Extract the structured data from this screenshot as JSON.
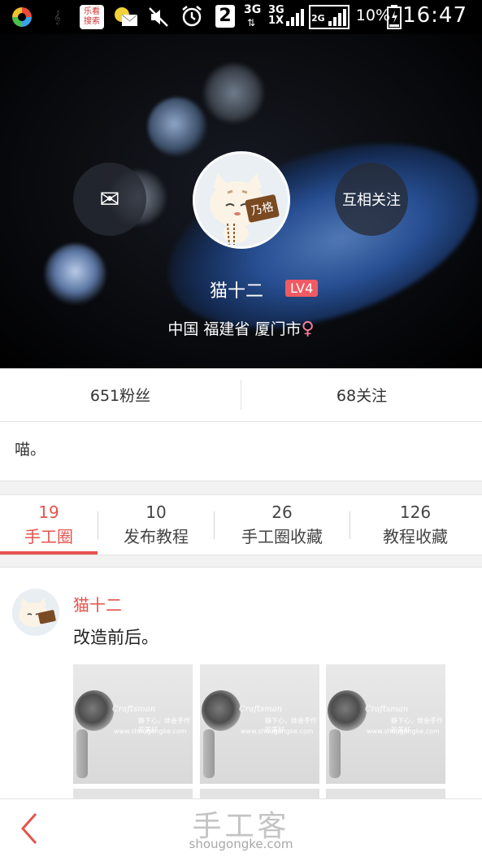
{
  "status_bar": {
    "app_badge": "乐看\n搜索",
    "notif_count": "2",
    "net_3g_top": "3G",
    "net_3g_1x": "3G\n1X",
    "net_2g": "2G",
    "battery": "10%",
    "time": "16:47",
    "icons": [
      "app-launcher-icon",
      "weather-icon",
      "leke-search-icon",
      "messages-icon",
      "mute-icon",
      "alarm-icon",
      "notification-count-icon",
      "signal-icon",
      "battery-icon"
    ]
  },
  "profile": {
    "name": "猫十二",
    "level": "LV4",
    "location": "中国 福建省 厦门市",
    "gender_symbol": "♀",
    "message_icon": "✉",
    "follow_each_other": "互相关注",
    "avatar_tag": "乃格"
  },
  "stats": {
    "fans": "651粉丝",
    "following": "68关注"
  },
  "bio": "喵。",
  "tabs": [
    {
      "count": "19",
      "label": "手工圈",
      "active": true
    },
    {
      "count": "10",
      "label": "发布教程",
      "active": false
    },
    {
      "count": "26",
      "label": "手工圈收藏",
      "active": false
    },
    {
      "count": "126",
      "label": "教程收藏",
      "active": false
    }
  ],
  "post": {
    "author": "猫十二",
    "text": "改造前后。",
    "thumb_text_1": "Craftsman",
    "thumb_text_2": "静下心，体会手作的美好",
    "thumb_text_3": "www.shougongke.com"
  },
  "bottom_bar": {
    "back_icon": "‹",
    "logo_cn": "手工客",
    "logo_en": "shougongke.com"
  },
  "colors": {
    "accent": "#e6534d",
    "level_badge": "#f05a63",
    "gender": "#f37f98"
  }
}
